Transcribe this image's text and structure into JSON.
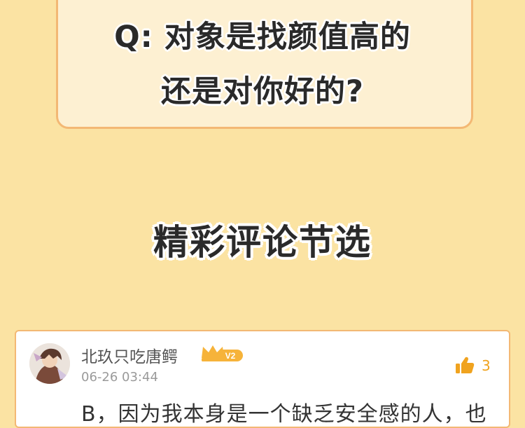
{
  "question": {
    "line1": "Q: 对象是找颜值高的",
    "line2": "还是对你好的?"
  },
  "section": {
    "title": "精彩评论节选"
  },
  "comment": {
    "username": "北玖只吃唐鳄",
    "vip_level": "V2",
    "timestamp": "06-26 03:44",
    "likes": "3",
    "text": "B，因为我本身是一个缺乏安全感的人，也"
  },
  "icons": {
    "vip": "crown-icon",
    "like": "thumbs-up-icon"
  },
  "colors": {
    "background": "#fbe3a3",
    "card_border": "#f3b874",
    "accent": "#f0a31f"
  }
}
